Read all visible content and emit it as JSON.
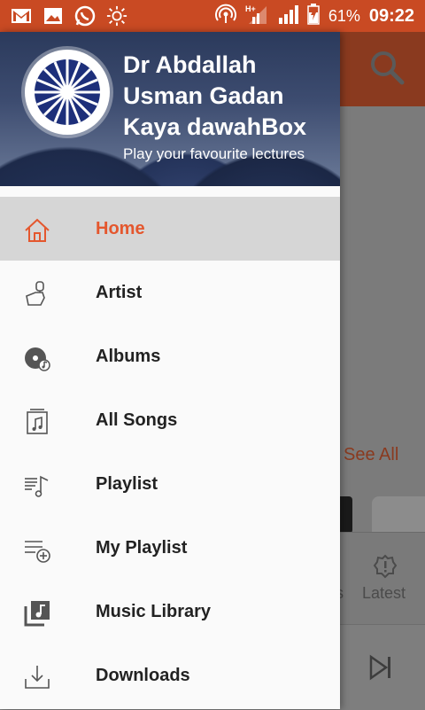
{
  "status_bar": {
    "battery": "61%",
    "time": "09:22",
    "left_icons": [
      "gmail-icon",
      "gallery-icon",
      "whatsapp-icon",
      "brightness-icon"
    ],
    "right_icons": [
      "hotspot-icon",
      "network-hplus-icon",
      "signal-icon",
      "battery-icon"
    ]
  },
  "drawer": {
    "title": "Dr Abdallah Usman Gadan Kaya dawahBox",
    "subtitle": "Play your favourite lectures",
    "items": [
      {
        "label": "Home",
        "icon": "home-icon",
        "selected": true
      },
      {
        "label": "Artist",
        "icon": "artist-icon"
      },
      {
        "label": "Albums",
        "icon": "album-icon"
      },
      {
        "label": "All Songs",
        "icon": "songs-icon"
      },
      {
        "label": "Playlist",
        "icon": "playlist-icon"
      },
      {
        "label": "My Playlist",
        "icon": "add-playlist-icon"
      },
      {
        "label": "Music Library",
        "icon": "library-icon"
      },
      {
        "label": "Downloads",
        "icon": "download-icon"
      }
    ]
  },
  "background": {
    "see_all": "See All",
    "tab_fragment": "s",
    "tab_latest": "Latest"
  },
  "colors": {
    "accent": "#e4572e",
    "status_bar": "#c94a23",
    "selected_bg": "#d6d6d6"
  }
}
